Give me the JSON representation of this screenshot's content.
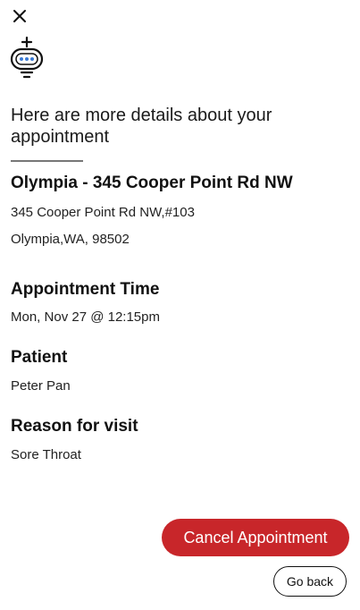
{
  "header": {
    "close_icon": "close-icon",
    "logo_icon": "robot-logo-icon",
    "title": "Here are more details about your appointment"
  },
  "location": {
    "name": "Olympia - 345 Cooper Point Rd NW",
    "address_line1": "345 Cooper Point Rd NW,#103",
    "address_line2": "Olympia,WA, 98502"
  },
  "appointment_time": {
    "label": "Appointment Time",
    "value": "Mon, Nov 27 @ 12:15pm"
  },
  "patient": {
    "label": "Patient",
    "value": "Peter Pan"
  },
  "reason": {
    "label": "Reason for visit",
    "value": "Sore Throat"
  },
  "actions": {
    "cancel_label": "Cancel Appointment",
    "back_label": "Go back"
  },
  "colors": {
    "cancel_button": "#c8262a",
    "logo_accent": "#3a7bd5"
  }
}
